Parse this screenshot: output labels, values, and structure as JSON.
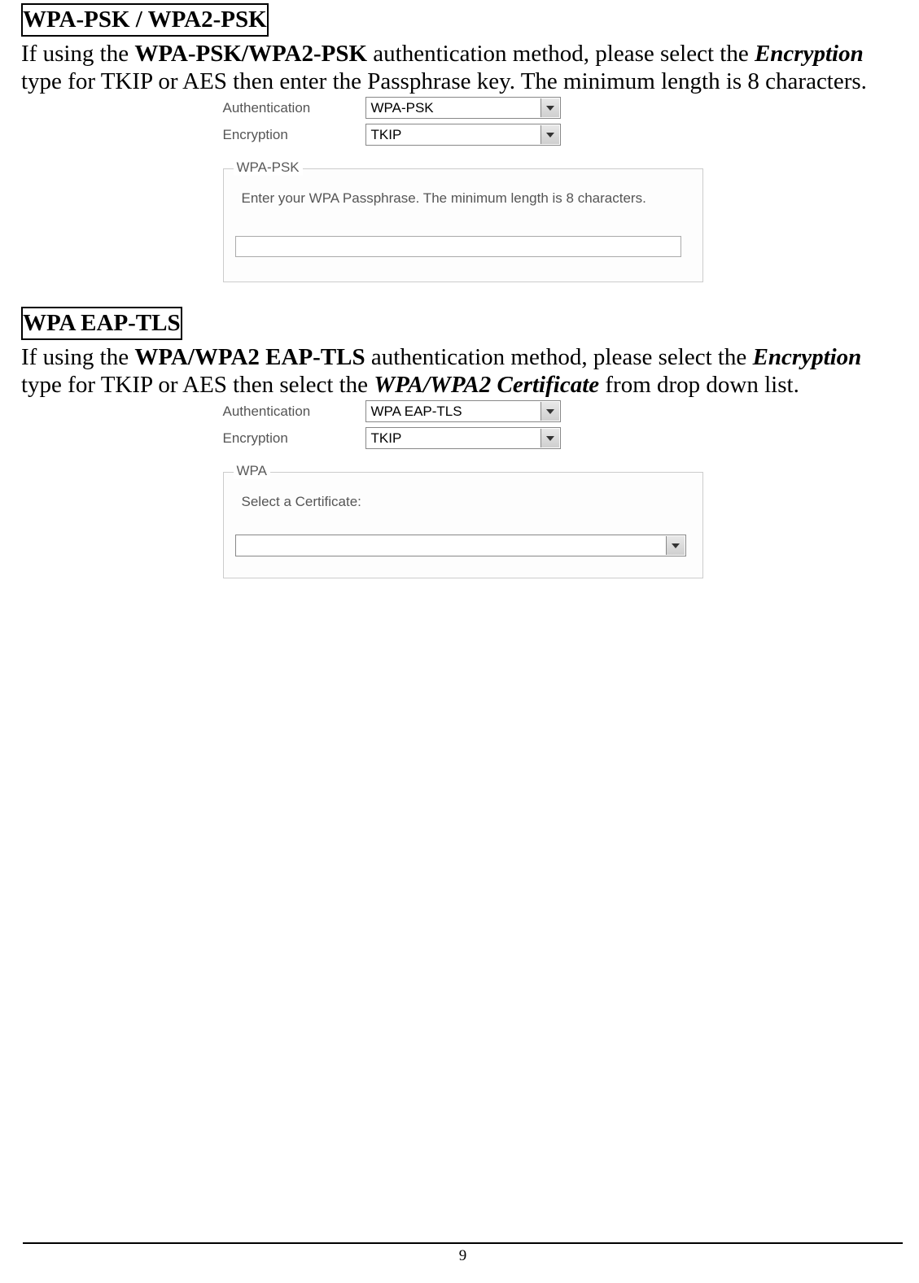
{
  "section1": {
    "heading": "WPA-PSK / WPA2-PSK",
    "para_prefix": "If using the ",
    "bold1": "WPA-PSK/WPA2-PSK",
    "para_mid1": " authentication method, please select the ",
    "italic1": "Encryption",
    "para_suffix": " type for TKIP or AES then enter the Passphrase key. The minimum length is 8 characters.",
    "form": {
      "auth_label": "Authentication",
      "auth_value": "WPA-PSK",
      "enc_label": "Encryption",
      "enc_value": "TKIP",
      "legend": "WPA-PSK",
      "instruction": "Enter your WPA Passphrase.  The minimum length is 8 characters.",
      "passphrase_value": ""
    }
  },
  "section2": {
    "heading": "WPA EAP-TLS",
    "para_prefix": "If using the ",
    "bold1": "WPA/WPA2 EAP-TLS",
    "para_mid1": " authentication method, please select the ",
    "italic1": "Encryption",
    "para_mid2": " type for TKIP or AES then select the ",
    "italic2": "WPA/WPA2 Certificate",
    "para_suffix": " from drop down list.",
    "form": {
      "auth_label": "Authentication",
      "auth_value": "WPA EAP-TLS",
      "enc_label": "Encryption",
      "enc_value": "TKIP",
      "legend": "WPA",
      "instruction": "Select a Certificate:",
      "cert_value": ""
    }
  },
  "page_number": "9"
}
